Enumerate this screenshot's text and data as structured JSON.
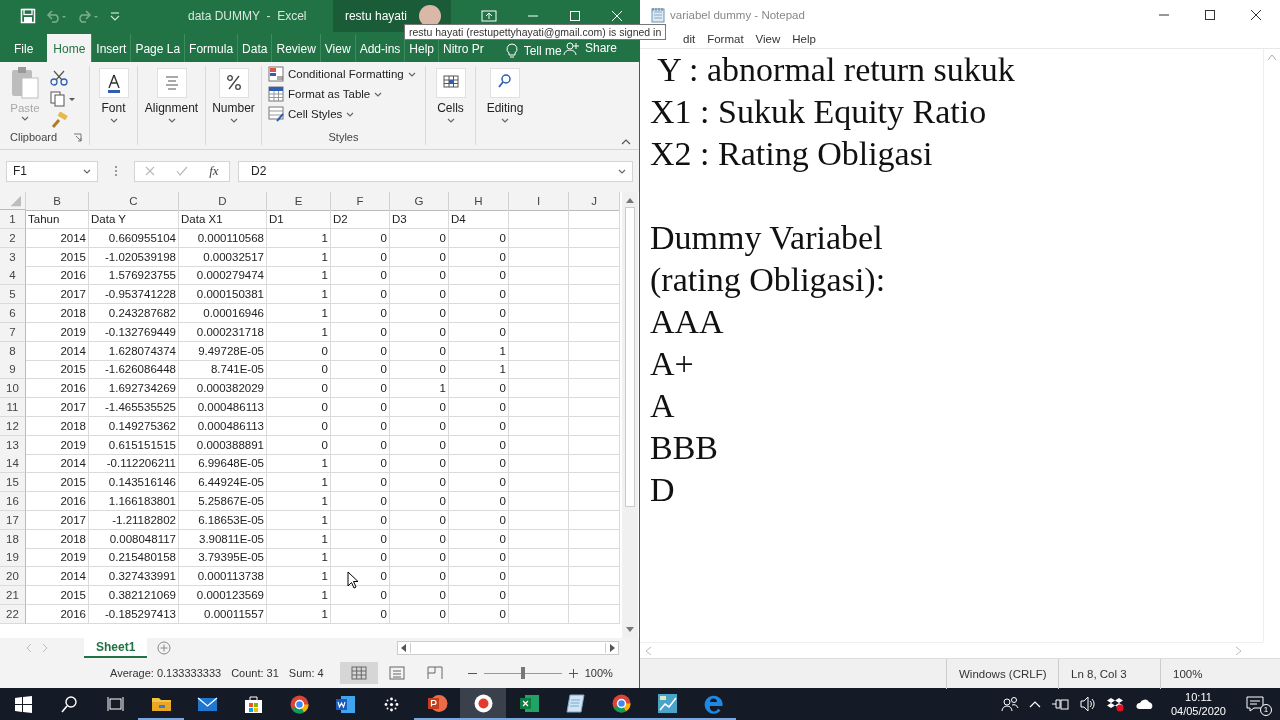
{
  "excel": {
    "title": "data DUMMY  -  Excel",
    "user": "restu hayati",
    "tooltip": "restu hayati (restupettyhayati@gmail.com) is signed in",
    "tabs": [
      {
        "label": "File",
        "selected": false
      },
      {
        "label": "Home",
        "selected": true
      },
      {
        "label": "Insert",
        "selected": false
      },
      {
        "label": "Page La",
        "selected": false
      },
      {
        "label": "Formula",
        "selected": false
      },
      {
        "label": "Data",
        "selected": false
      },
      {
        "label": "Review",
        "selected": false
      },
      {
        "label": "View",
        "selected": false
      },
      {
        "label": "Add-ins",
        "selected": false
      },
      {
        "label": "Help",
        "selected": false
      },
      {
        "label": "Nitro Pr",
        "selected": false
      }
    ],
    "tell_me": "Tell me",
    "share": "Share",
    "ribbon": [
      {
        "kind": "clipboard",
        "label": "Clipboard",
        "paste": "Paste",
        "paste_disabled": true
      },
      {
        "kind": "font",
        "label": "Font"
      },
      {
        "kind": "alignment",
        "label": "Alignment"
      },
      {
        "kind": "number",
        "label": "Number"
      },
      {
        "kind": "styles",
        "label": "Styles",
        "items": [
          "Conditional Formatting",
          "Format as Table",
          "Cell Styles"
        ]
      },
      {
        "kind": "cells",
        "label": "Cells"
      },
      {
        "kind": "editing",
        "label": "Editing"
      }
    ],
    "name_box": "F1",
    "function_label": "fx",
    "formula": "D2",
    "columns": [
      "B",
      "C",
      "D",
      "E",
      "F",
      "G",
      "H",
      "I",
      "J"
    ],
    "rows": [
      {
        "number": "1",
        "kind": "header",
        "cells": [
          "Tahun",
          "Data Y",
          "Data X1",
          "D1",
          "D2",
          "D3",
          "D4"
        ]
      },
      {
        "number": "2",
        "kind": "data",
        "cells": [
          "2014",
          "0.660955104",
          "0.000110568",
          "1",
          "0",
          "0",
          "0"
        ]
      },
      {
        "number": "3",
        "kind": "data",
        "cells": [
          "2015",
          "-1.020539198",
          "0.00032517",
          "1",
          "0",
          "0",
          "0"
        ]
      },
      {
        "number": "4",
        "kind": "data",
        "cells": [
          "2016",
          "1.576923755",
          "0.000279474",
          "1",
          "0",
          "0",
          "0"
        ]
      },
      {
        "number": "5",
        "kind": "data",
        "cells": [
          "2017",
          "-0.953741228",
          "0.000150381",
          "1",
          "0",
          "0",
          "0"
        ]
      },
      {
        "number": "6",
        "kind": "data",
        "cells": [
          "2018",
          "0.243287682",
          "0.00016946",
          "1",
          "0",
          "0",
          "0"
        ]
      },
      {
        "number": "7",
        "kind": "data",
        "cells": [
          "2019",
          "-0.132769449",
          "0.000231718",
          "1",
          "0",
          "0",
          "0"
        ]
      },
      {
        "number": "8",
        "kind": "data",
        "cells": [
          "2014",
          "1.628074374",
          "9.49728E-05",
          "0",
          "0",
          "0",
          "1"
        ]
      },
      {
        "number": "9",
        "kind": "data",
        "cells": [
          "2015",
          "-1.626086448",
          "8.741E-05",
          "0",
          "0",
          "0",
          "1"
        ]
      },
      {
        "number": "10",
        "kind": "data",
        "cells": [
          "2016",
          "1.692734269",
          "0.000382029",
          "0",
          "0",
          "1",
          "0"
        ]
      },
      {
        "number": "11",
        "kind": "data",
        "cells": [
          "2017",
          "-1.465535525",
          "0.000486113",
          "0",
          "0",
          "0",
          "0"
        ]
      },
      {
        "number": "12",
        "kind": "data",
        "cells": [
          "2018",
          "0.149275362",
          "0.000486113",
          "0",
          "0",
          "0",
          "0"
        ]
      },
      {
        "number": "13",
        "kind": "data",
        "cells": [
          "2019",
          "0.615151515",
          "0.000388891",
          "0",
          "0",
          "0",
          "0"
        ]
      },
      {
        "number": "14",
        "kind": "data",
        "cells": [
          "2014",
          "-0.112206211",
          "6.99648E-05",
          "1",
          "0",
          "0",
          "0"
        ]
      },
      {
        "number": "15",
        "kind": "data",
        "cells": [
          "2015",
          "0.143516146",
          "6.44924E-05",
          "1",
          "0",
          "0",
          "0"
        ]
      },
      {
        "number": "16",
        "kind": "data",
        "cells": [
          "2016",
          "1.166183801",
          "5.25867E-05",
          "1",
          "0",
          "0",
          "0"
        ]
      },
      {
        "number": "17",
        "kind": "data",
        "cells": [
          "2017",
          "-1.21182802",
          "6.18653E-05",
          "1",
          "0",
          "0",
          "0"
        ]
      },
      {
        "number": "18",
        "kind": "data",
        "cells": [
          "2018",
          "0.008048117",
          "3.90811E-05",
          "1",
          "0",
          "0",
          "0"
        ]
      },
      {
        "number": "19",
        "kind": "data",
        "cells": [
          "2019",
          "0.215480158",
          "3.79395E-05",
          "1",
          "0",
          "0",
          "0"
        ]
      },
      {
        "number": "20",
        "kind": "data",
        "cells": [
          "2014",
          "0.327433991",
          "0.000113738",
          "1",
          "0",
          "0",
          "0"
        ]
      },
      {
        "number": "21",
        "kind": "data",
        "cells": [
          "2015",
          "0.382121069",
          "0.000123569",
          "1",
          "0",
          "0",
          "0"
        ]
      },
      {
        "number": "22",
        "kind": "data",
        "cells": [
          "2016",
          "-0.185297413",
          "0.00011557",
          "1",
          "0",
          "0",
          "0"
        ]
      }
    ],
    "sheets": [
      {
        "label": "Sheet1",
        "selected": true
      }
    ],
    "status": {
      "average": "Average: 0.133333333",
      "count": "Count: 31",
      "sum": "Sum: 4",
      "zoom": "100%",
      "zoom_level": {
        "level": 0.5
      }
    }
  },
  "notepad": {
    "title": "variabel dummy - Notepad",
    "menu": [
      "dit",
      "Format",
      "View",
      "Help"
    ],
    "paragraphs": [
      [
        " Y : abnormal return sukuk",
        "X1 : Sukuk Equity Ratio",
        "X2 : Rating Obligasi"
      ],
      [
        "Dummy Variabel",
        "(rating Obligasi):",
        "AAA",
        "A+",
        "A",
        "BBB",
        "D"
      ]
    ],
    "status": [
      "Windows (CRLF)",
      "Ln 8, Col 3",
      "100%"
    ]
  },
  "taskbar": {
    "buttons": [
      {
        "kind": "start",
        "open": false,
        "selected": false
      },
      {
        "kind": "search",
        "open": false,
        "selected": false
      },
      {
        "kind": "taskview",
        "open": false,
        "selected": false
      },
      {
        "kind": "folder",
        "open": true,
        "selected": false
      },
      {
        "kind": "mail",
        "open": false,
        "selected": false
      },
      {
        "kind": "store",
        "open": false,
        "selected": false
      },
      {
        "kind": "browser",
        "open": false,
        "selected": false
      },
      {
        "kind": "word",
        "open": false,
        "selected": false
      },
      {
        "kind": "dots",
        "open": false,
        "selected": false
      },
      {
        "kind": "slides",
        "open": true,
        "selected": false
      },
      {
        "kind": "record",
        "open": true,
        "selected": true
      },
      {
        "kind": "excel",
        "open": true,
        "selected": false
      },
      {
        "kind": "notepad",
        "open": true,
        "selected": false
      },
      {
        "kind": "browser",
        "open": true,
        "selected": false
      },
      {
        "kind": "chart",
        "open": true,
        "selected": false
      },
      {
        "kind": "edge",
        "open": true,
        "selected": false
      }
    ],
    "time": "10:11",
    "date": "04/05/2020",
    "notifications": "1"
  }
}
